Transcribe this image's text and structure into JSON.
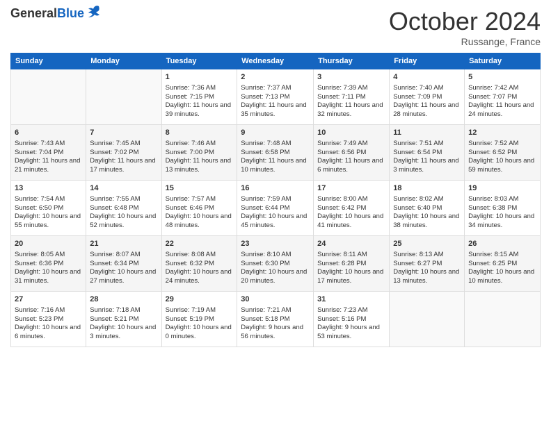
{
  "header": {
    "logo_general": "General",
    "logo_blue": "Blue",
    "title": "October 2024",
    "location": "Russange, France"
  },
  "days_of_week": [
    "Sunday",
    "Monday",
    "Tuesday",
    "Wednesday",
    "Thursday",
    "Friday",
    "Saturday"
  ],
  "weeks": [
    [
      {
        "day": "",
        "info": ""
      },
      {
        "day": "",
        "info": ""
      },
      {
        "day": "1",
        "info": "Sunrise: 7:36 AM\nSunset: 7:15 PM\nDaylight: 11 hours and 39 minutes."
      },
      {
        "day": "2",
        "info": "Sunrise: 7:37 AM\nSunset: 7:13 PM\nDaylight: 11 hours and 35 minutes."
      },
      {
        "day": "3",
        "info": "Sunrise: 7:39 AM\nSunset: 7:11 PM\nDaylight: 11 hours and 32 minutes."
      },
      {
        "day": "4",
        "info": "Sunrise: 7:40 AM\nSunset: 7:09 PM\nDaylight: 11 hours and 28 minutes."
      },
      {
        "day": "5",
        "info": "Sunrise: 7:42 AM\nSunset: 7:07 PM\nDaylight: 11 hours and 24 minutes."
      }
    ],
    [
      {
        "day": "6",
        "info": "Sunrise: 7:43 AM\nSunset: 7:04 PM\nDaylight: 11 hours and 21 minutes."
      },
      {
        "day": "7",
        "info": "Sunrise: 7:45 AM\nSunset: 7:02 PM\nDaylight: 11 hours and 17 minutes."
      },
      {
        "day": "8",
        "info": "Sunrise: 7:46 AM\nSunset: 7:00 PM\nDaylight: 11 hours and 13 minutes."
      },
      {
        "day": "9",
        "info": "Sunrise: 7:48 AM\nSunset: 6:58 PM\nDaylight: 11 hours and 10 minutes."
      },
      {
        "day": "10",
        "info": "Sunrise: 7:49 AM\nSunset: 6:56 PM\nDaylight: 11 hours and 6 minutes."
      },
      {
        "day": "11",
        "info": "Sunrise: 7:51 AM\nSunset: 6:54 PM\nDaylight: 11 hours and 3 minutes."
      },
      {
        "day": "12",
        "info": "Sunrise: 7:52 AM\nSunset: 6:52 PM\nDaylight: 10 hours and 59 minutes."
      }
    ],
    [
      {
        "day": "13",
        "info": "Sunrise: 7:54 AM\nSunset: 6:50 PM\nDaylight: 10 hours and 55 minutes."
      },
      {
        "day": "14",
        "info": "Sunrise: 7:55 AM\nSunset: 6:48 PM\nDaylight: 10 hours and 52 minutes."
      },
      {
        "day": "15",
        "info": "Sunrise: 7:57 AM\nSunset: 6:46 PM\nDaylight: 10 hours and 48 minutes."
      },
      {
        "day": "16",
        "info": "Sunrise: 7:59 AM\nSunset: 6:44 PM\nDaylight: 10 hours and 45 minutes."
      },
      {
        "day": "17",
        "info": "Sunrise: 8:00 AM\nSunset: 6:42 PM\nDaylight: 10 hours and 41 minutes."
      },
      {
        "day": "18",
        "info": "Sunrise: 8:02 AM\nSunset: 6:40 PM\nDaylight: 10 hours and 38 minutes."
      },
      {
        "day": "19",
        "info": "Sunrise: 8:03 AM\nSunset: 6:38 PM\nDaylight: 10 hours and 34 minutes."
      }
    ],
    [
      {
        "day": "20",
        "info": "Sunrise: 8:05 AM\nSunset: 6:36 PM\nDaylight: 10 hours and 31 minutes."
      },
      {
        "day": "21",
        "info": "Sunrise: 8:07 AM\nSunset: 6:34 PM\nDaylight: 10 hours and 27 minutes."
      },
      {
        "day": "22",
        "info": "Sunrise: 8:08 AM\nSunset: 6:32 PM\nDaylight: 10 hours and 24 minutes."
      },
      {
        "day": "23",
        "info": "Sunrise: 8:10 AM\nSunset: 6:30 PM\nDaylight: 10 hours and 20 minutes."
      },
      {
        "day": "24",
        "info": "Sunrise: 8:11 AM\nSunset: 6:28 PM\nDaylight: 10 hours and 17 minutes."
      },
      {
        "day": "25",
        "info": "Sunrise: 8:13 AM\nSunset: 6:27 PM\nDaylight: 10 hours and 13 minutes."
      },
      {
        "day": "26",
        "info": "Sunrise: 8:15 AM\nSunset: 6:25 PM\nDaylight: 10 hours and 10 minutes."
      }
    ],
    [
      {
        "day": "27",
        "info": "Sunrise: 7:16 AM\nSunset: 5:23 PM\nDaylight: 10 hours and 6 minutes."
      },
      {
        "day": "28",
        "info": "Sunrise: 7:18 AM\nSunset: 5:21 PM\nDaylight: 10 hours and 3 minutes."
      },
      {
        "day": "29",
        "info": "Sunrise: 7:19 AM\nSunset: 5:19 PM\nDaylight: 10 hours and 0 minutes."
      },
      {
        "day": "30",
        "info": "Sunrise: 7:21 AM\nSunset: 5:18 PM\nDaylight: 9 hours and 56 minutes."
      },
      {
        "day": "31",
        "info": "Sunrise: 7:23 AM\nSunset: 5:16 PM\nDaylight: 9 hours and 53 minutes."
      },
      {
        "day": "",
        "info": ""
      },
      {
        "day": "",
        "info": ""
      }
    ]
  ]
}
